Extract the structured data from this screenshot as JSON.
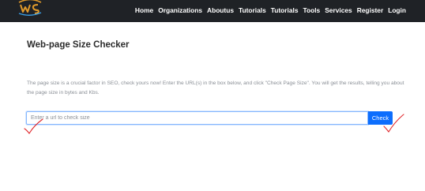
{
  "nav": {
    "logo": "site-logo",
    "items": [
      "Home",
      "Organizations",
      "Aboutus",
      "Tutorials",
      "Tutorials",
      "Tools",
      "Services",
      "Register",
      "Login"
    ]
  },
  "page": {
    "title": "Web-page Size Checker",
    "description": "The page size is a crucial factor in SEO, check yours now! Enter the URL(s) in the box below, and click \"Check Page Size\". You will get the results, telling you about the page size in bytes and Kbs."
  },
  "form": {
    "url_placeholder": "Enter a url to check size",
    "url_value": "",
    "check_label": "Check"
  },
  "colors": {
    "navbar_bg": "#1f2226",
    "button_bg": "#0d6efd",
    "annotation": "#e0262b"
  },
  "annotations": {
    "marks": [
      "red-checkmark",
      "red-checkmark"
    ]
  }
}
